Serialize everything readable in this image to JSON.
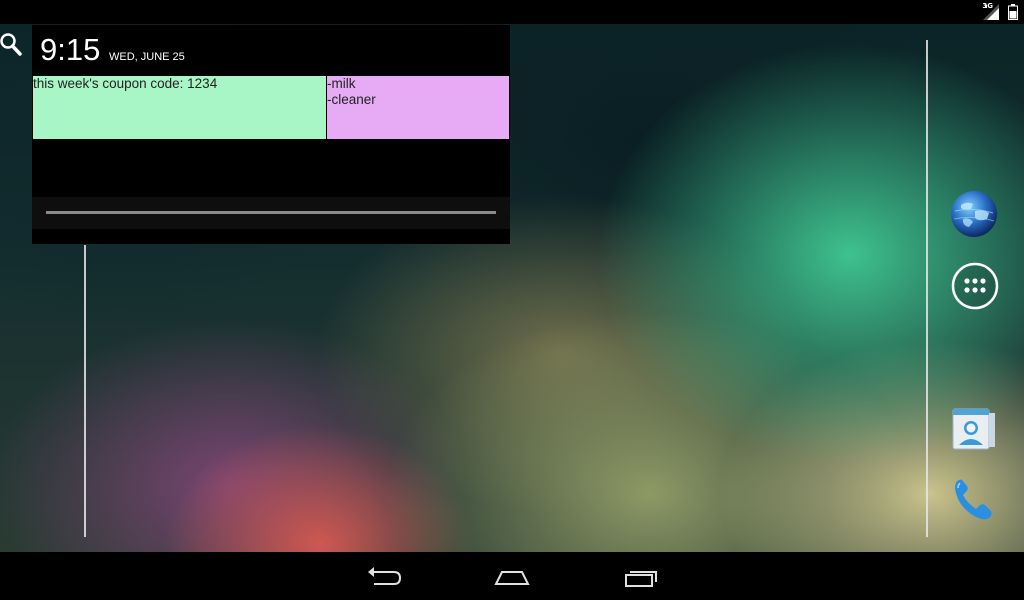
{
  "status_bar": {
    "network_label": "3G",
    "icons": [
      "signal-icon",
      "battery-icon"
    ]
  },
  "clock": {
    "time": "9:15",
    "date": "WED, JUNE 25"
  },
  "notes": {
    "coupon": {
      "lines": [
        "this week's coupon code: 1234"
      ],
      "color": "#a8f5c6"
    },
    "shopping_list": {
      "lines": [
        "-milk",
        "-cleaner"
      ],
      "color": "#e6abf4"
    }
  },
  "dock": {
    "icons": [
      "browser-globe-icon",
      "all-apps-icon",
      "people-icon",
      "phone-icon"
    ]
  },
  "nav_bar": {
    "icons": [
      "back-icon",
      "home-icon",
      "recent-apps-icon"
    ]
  },
  "colors": {
    "accent_blue": "#2a8fe0",
    "wallpaper_green": "#46dca0",
    "wallpaper_red": "#dc5a50"
  }
}
